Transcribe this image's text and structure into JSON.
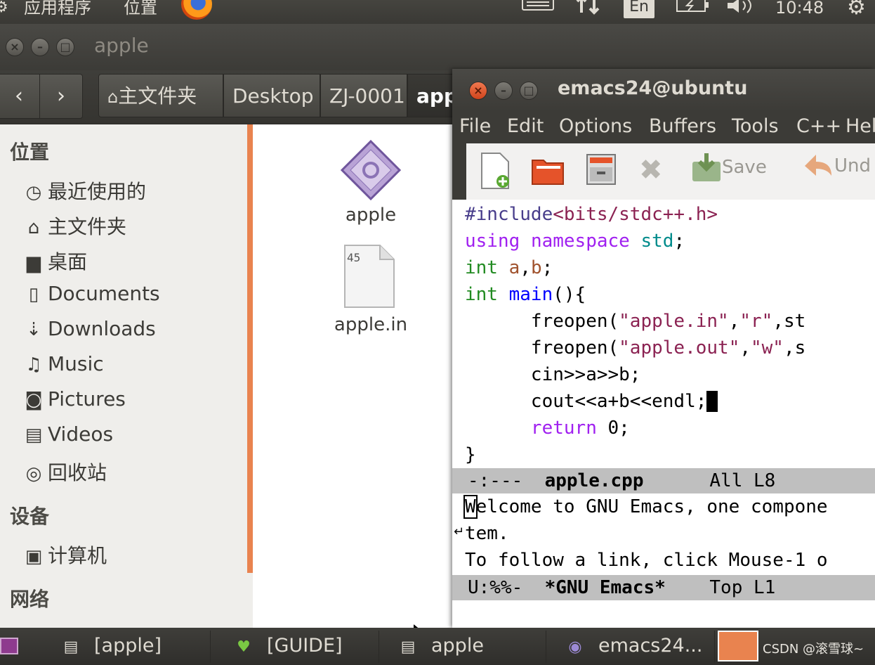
{
  "top_panel": {
    "applications": "应用程序",
    "places": "位置",
    "input_method": "En",
    "clock": "10:48"
  },
  "nautilus": {
    "title": "apple",
    "breadcrumbs": [
      "主文件夹",
      "Desktop",
      "ZJ-0001",
      "app"
    ],
    "sidebar": {
      "heading_places": "位置",
      "places": [
        {
          "icon": "clock-icon",
          "label": "最近使用的"
        },
        {
          "icon": "home-icon",
          "label": "主文件夹"
        },
        {
          "icon": "folder-icon",
          "label": "桌面"
        },
        {
          "icon": "document-icon",
          "label": "Documents"
        },
        {
          "icon": "download-icon",
          "label": "Downloads"
        },
        {
          "icon": "music-icon",
          "label": "Music"
        },
        {
          "icon": "camera-icon",
          "label": "Pictures"
        },
        {
          "icon": "film-icon",
          "label": "Videos"
        },
        {
          "icon": "trash-icon",
          "label": "回收站"
        }
      ],
      "heading_devices": "设备",
      "devices": [
        {
          "icon": "computer-icon",
          "label": "计算机"
        }
      ],
      "heading_network": "网络"
    },
    "files": [
      {
        "name": "apple",
        "icon": "executable-icon"
      },
      {
        "name": "apple.in",
        "icon": "text-file-icon",
        "thumb_text": "45"
      }
    ]
  },
  "emacs": {
    "title": "emacs24@ubuntu",
    "menu": [
      "File",
      "Edit",
      "Options",
      "Buffers",
      "Tools",
      "C++",
      "Hel"
    ],
    "toolbar": {
      "save": "Save",
      "undo": "Und"
    },
    "code": {
      "l1_pp": "#include",
      "l1_hdr": "<bits/stdc++.h>",
      "l2_kw1": "using",
      "l2_kw2": "namespace",
      "l2_ns": "std",
      "l2_end": ";",
      "l3_ty": "int",
      "l3_sp": " ",
      "l3_a": "a",
      "l3_comma": ",",
      "l3_b": "b",
      "l3_end": ";",
      "l4_ty": "int",
      "l4_fn": "main",
      "l4_end": "(){",
      "l5_fn": "freopen(",
      "l5_s1": "\"apple.in\"",
      "l5_c": ",",
      "l5_s2": "\"r\"",
      "l5_end": ",st",
      "l6_fn": "freopen(",
      "l6_s1": "\"apple.out\"",
      "l6_c": ",",
      "l6_s2": "\"w\"",
      "l6_end": ",s",
      "l7": "cin>>a>>b;",
      "l8": "cout<<a+b<<endl;",
      "l9_kw": "return",
      "l9_end": " 0;",
      "l10": "}"
    },
    "mode_line_1": {
      "status": "-:---",
      "buffer": "apple.cpp",
      "pos": "All L8"
    },
    "echo": {
      "line1_first": "W",
      "line1_rest": "elcome to GNU Emacs, one compone",
      "line2": "tem.",
      "line3": "To follow a link, click Mouse-1 o"
    },
    "mode_line_2": {
      "status": "U:%%-",
      "buffer": "*GNU Emacs*",
      "pos": "Top L1"
    }
  },
  "taskbar": {
    "tasks": [
      {
        "icon": "file-manager-icon",
        "label": "[apple]"
      },
      {
        "icon": "heart-icon",
        "label": "[GUIDE]"
      },
      {
        "icon": "file-manager-icon",
        "label": "apple"
      },
      {
        "icon": "emacs-icon",
        "label": "emacs24..."
      }
    ],
    "watermark": "CSDN @滚雪球~"
  }
}
